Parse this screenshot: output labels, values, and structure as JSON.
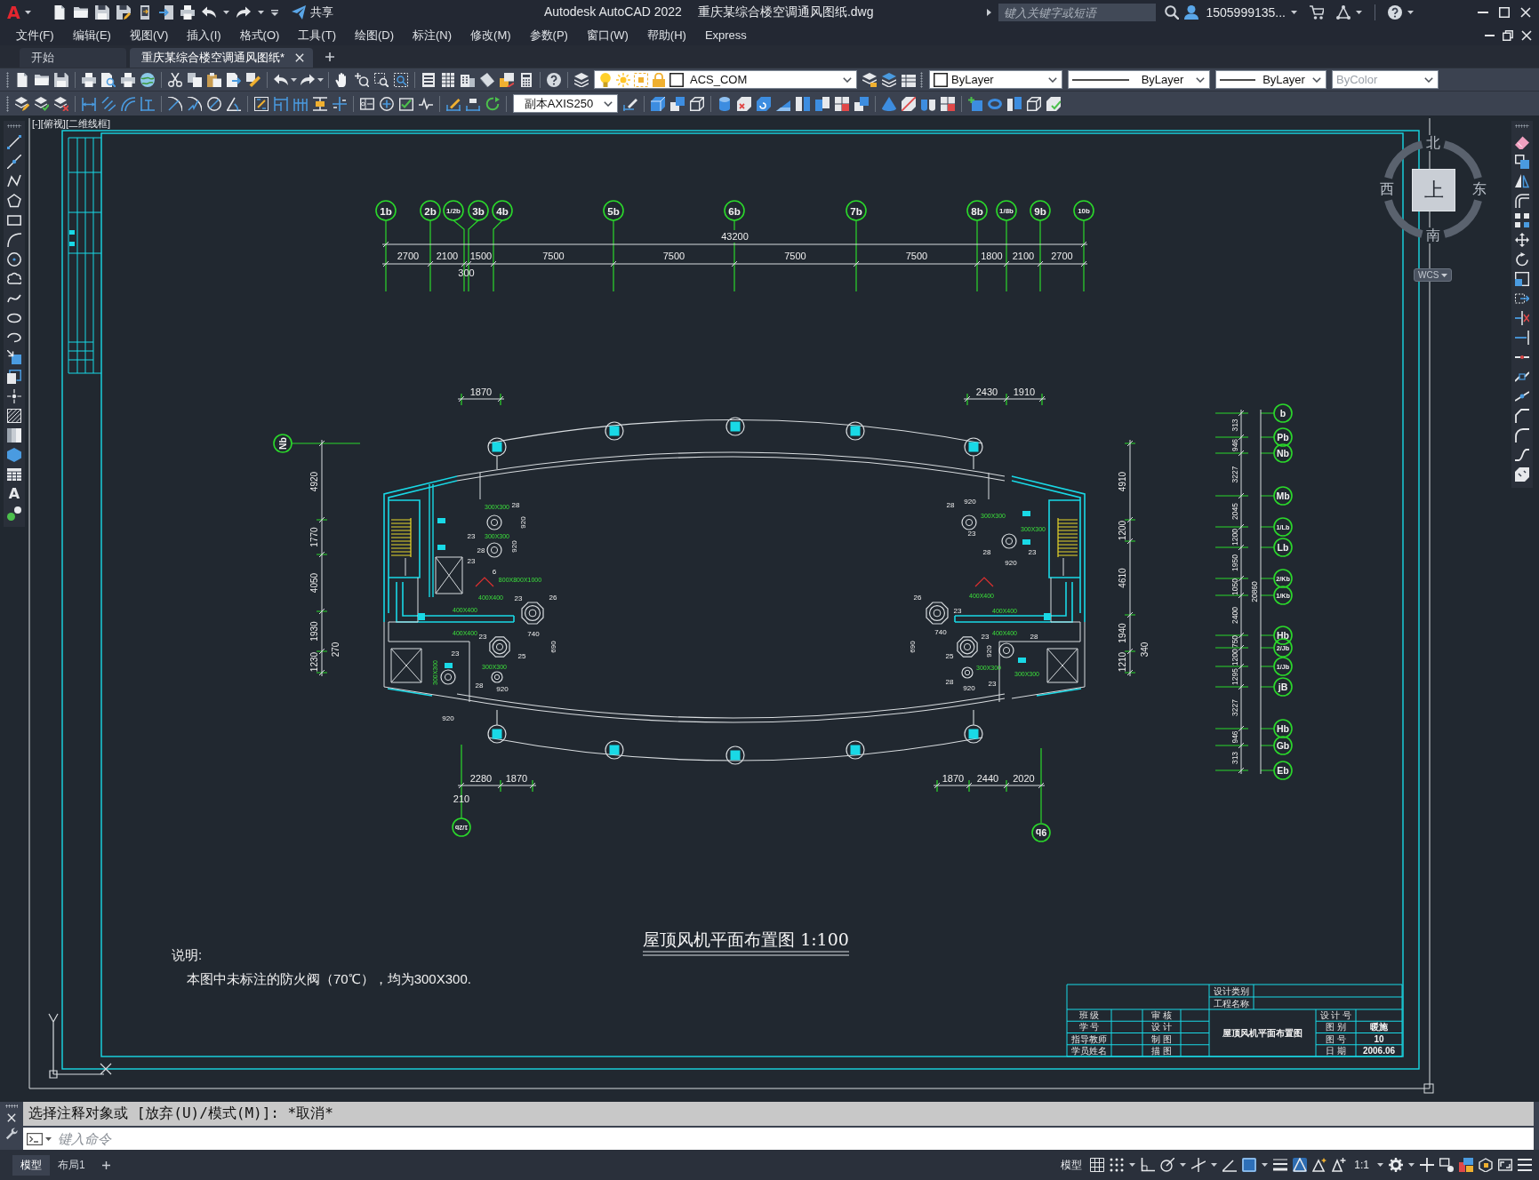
{
  "app_logo": "A",
  "window": {
    "app_title": "Autodesk AutoCAD 2022",
    "file_title": "重庆某综合楼空调通风图纸.dwg"
  },
  "share_label": "共享",
  "search": {
    "placeholder": "键入关键字或短语"
  },
  "account": {
    "user_name": "1505999135..."
  },
  "menu": [
    "文件(F)",
    "编辑(E)",
    "视图(V)",
    "插入(I)",
    "格式(O)",
    "工具(T)",
    "绘图(D)",
    "标注(N)",
    "修改(M)",
    "参数(P)",
    "窗口(W)",
    "帮助(H)",
    "Express"
  ],
  "file_tabs": [
    {
      "label": "开始",
      "selected": false
    },
    {
      "label": "重庆某综合楼空调通风图纸*",
      "selected": true
    }
  ],
  "properties": {
    "layer": "ACS_COM",
    "color_setting": "ByLayer",
    "linetype": "ByLayer",
    "lineweight": "ByLayer",
    "plot_style": {
      "value": "ByColor",
      "disabled": true
    }
  },
  "dim_style": "副本AXIS250",
  "draw_palette": {
    "text_tool": "A"
  },
  "viewport_label": "[-][俯视][二维线框]",
  "viewcube": {
    "north": "北",
    "south": "南",
    "west": "西",
    "east": "东",
    "face": "上",
    "coordinate_system": "WCS"
  },
  "drawing": {
    "top_axes": [
      "1b",
      "2b",
      "1/2b",
      "3b",
      "4b",
      "5b",
      "6b",
      "7b",
      "8b",
      "1/8b",
      "9b",
      "10b"
    ],
    "top_overall_dimension": "43200",
    "top_dimensions": [
      "2700",
      "2100",
      "300",
      "1500",
      "7500",
      "7500",
      "7500",
      "7500",
      "1800",
      "2100",
      "2700"
    ],
    "upper_left_dimensions": [
      "1870"
    ],
    "upper_right_dimensions": [
      "2430",
      "1910"
    ],
    "left_axis": "Nb",
    "left_dimensions": [
      "4920",
      "1770",
      "4050",
      "1930",
      "1230"
    ],
    "left_extra_dimension": "270",
    "right_dimensions": [
      "4910",
      "1200",
      "4610",
      "1940",
      "1210"
    ],
    "right_extra_dimension": "340",
    "lower_left_dimensions": [
      "2280",
      "1870"
    ],
    "lower_left_extra_dimension": "210",
    "lower_left_axis": "1/2b",
    "lower_right_dimensions": [
      "1870",
      "2440",
      "2020"
    ],
    "lower_right_axis": "9b",
    "side_axes": [
      "b",
      "Pb",
      "Nb",
      "Mb",
      "1/Lb",
      "Lb",
      "2/Kb",
      "1/Kb",
      "Hb",
      "2/Jb",
      "1/Jb",
      "jB",
      "Hb",
      "Gb",
      "Eb"
    ],
    "side_dimensions": [
      "313",
      "946",
      "3227",
      "2045",
      "1200",
      "1950",
      "1050",
      "2400",
      "750",
      "1200",
      "1295",
      "3227",
      "946",
      "313"
    ],
    "side_overall_dimension": "20860",
    "duct_labels": [
      "300X300",
      "300X300",
      "300X300",
      "300X300",
      "800X800X1000",
      "400X400",
      "400X400",
      "400X400",
      "400X400",
      "400X400",
      "400X400",
      "300X300",
      "300X300",
      "300X300",
      "300X300"
    ],
    "equipment_tags": [
      "28",
      "28",
      "920",
      "920",
      "23",
      "23",
      "28",
      "920",
      "28",
      "23",
      "23",
      "920",
      "6",
      "23",
      "26",
      "26",
      "23",
      "23",
      "740",
      "740",
      "23",
      "28",
      "23",
      "25",
      "690",
      "690",
      "25",
      "920",
      "28",
      "920",
      "28",
      "920",
      "23",
      "920"
    ],
    "title": "屋顶风机平面布置图 1:100",
    "notes_heading": "说明:",
    "notes_text": "本图中未标注的防火阀（70℃），均为300X300.",
    "title_block": {
      "category_label": "设计类别",
      "project_label": "工程名称",
      "left_labels": [
        "班 级",
        "学 号",
        "指导教师",
        "学员姓名"
      ],
      "middle_labels": [
        "审 核",
        "设 计",
        "制 图",
        "描 图"
      ],
      "drawing_name": "屋顶风机平面布置图",
      "info": [
        {
          "label": "设 计 号"
        },
        {
          "label": "图 别",
          "value": "暖施"
        },
        {
          "label": "图 号",
          "value": "10"
        },
        {
          "label": "日 期",
          "value": "2006.06"
        }
      ]
    }
  },
  "command_line": {
    "history": "选择注释对象或 [放弃(U)/模式(M)]: *取消*",
    "placeholder": "键入命令"
  },
  "layout_tabs": [
    {
      "label": "模型",
      "selected": true
    },
    {
      "label": "布局1",
      "selected": false
    }
  ],
  "status_bar": {
    "model_button": "模型",
    "annotation_scale": "1:1",
    "toggles": [
      {
        "on": false
      },
      {
        "on": false
      },
      {
        "on": false
      },
      {
        "on": false
      },
      {
        "on": false
      },
      {
        "on": false
      },
      {
        "on": true
      },
      {
        "on": false
      },
      {
        "on": true
      },
      {
        "on": false
      },
      {
        "on": false
      }
    ]
  }
}
